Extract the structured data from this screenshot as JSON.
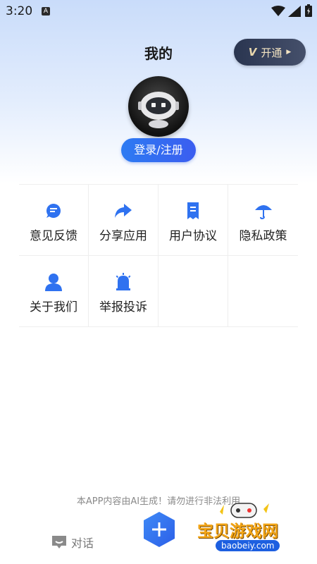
{
  "status_bar": {
    "time": "3:20",
    "notif_letter": "A"
  },
  "header": {
    "title": "我的",
    "vip_label": "开通",
    "vip_badge": "V"
  },
  "profile": {
    "login_label": "登录/注册"
  },
  "menu": [
    {
      "key": "feedback",
      "label": "意见反馈",
      "icon": "chat-bubble-icon"
    },
    {
      "key": "share",
      "label": "分享应用",
      "icon": "share-arrow-icon"
    },
    {
      "key": "agreement",
      "label": "用户协议",
      "icon": "document-icon"
    },
    {
      "key": "privacy",
      "label": "隐私政策",
      "icon": "umbrella-icon"
    },
    {
      "key": "about",
      "label": "关于我们",
      "icon": "person-icon"
    },
    {
      "key": "report",
      "label": "举报投诉",
      "icon": "alarm-icon"
    }
  ],
  "footer": {
    "notice": "本APP内容由AI生成！请勿进行非法利用",
    "tab_chat": "对话",
    "fab_symbol": "+"
  },
  "watermark": {
    "title": "宝贝游戏网",
    "url": "baobeiy.com"
  },
  "colors": {
    "accent": "#2d6ff0",
    "vip_text": "#f3e4c2",
    "vip_bg": "#2a3550"
  }
}
